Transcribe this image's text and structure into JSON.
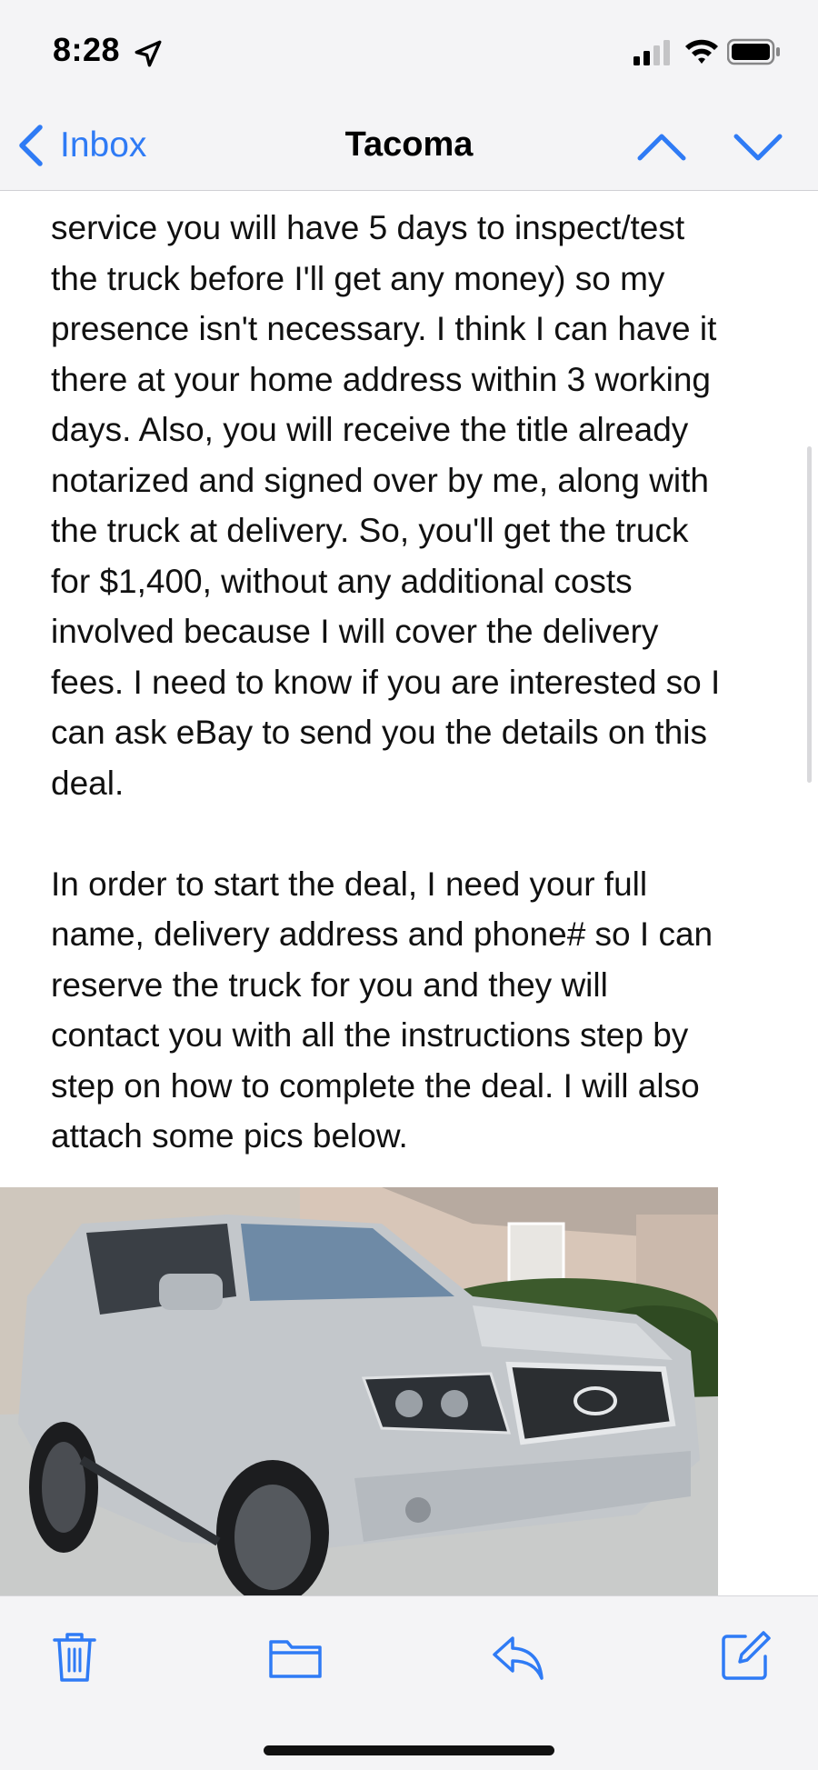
{
  "status_bar": {
    "time": "8:28",
    "location_icon": "location-arrow-icon",
    "signal_icon": "cellular-signal-icon",
    "wifi_icon": "wifi-icon",
    "battery_icon": "battery-icon"
  },
  "nav": {
    "back_label": "Inbox",
    "title": "Tacoma",
    "prev_icon": "chevron-up-icon",
    "next_icon": "chevron-down-icon"
  },
  "email": {
    "paragraph1_lines": [
      "service you will have 5 days to inspect/test",
      "the truck before I'll get any money) so my",
      "presence isn't necessary. I think I can have it",
      "there at your home address within 3 working",
      "days. Also, you will receive the title already",
      "notarized and signed over by me, along with",
      "the truck at delivery. So, you'll get the truck",
      "for $1,400, without any additional costs",
      "involved because I will cover the delivery",
      "fees. I need to know if you are interested so I",
      "can ask eBay to  send you the details on this",
      "deal."
    ],
    "paragraph2_lines": [
      "In order to start the deal, I need your full",
      "name, delivery address and phone# so I can",
      "reserve the truck for you and they will",
      "contact you with all the instructions step by",
      "step on how to complete the deal. I will also",
      "attach some pics below."
    ]
  },
  "toolbar": {
    "trash_icon": "trash-icon",
    "folder_icon": "folder-icon",
    "reply_icon": "reply-icon",
    "compose_icon": "compose-icon"
  },
  "colors": {
    "accent": "#2f7bf5",
    "bar_background": "#f4f4f6",
    "text": "#111111"
  }
}
